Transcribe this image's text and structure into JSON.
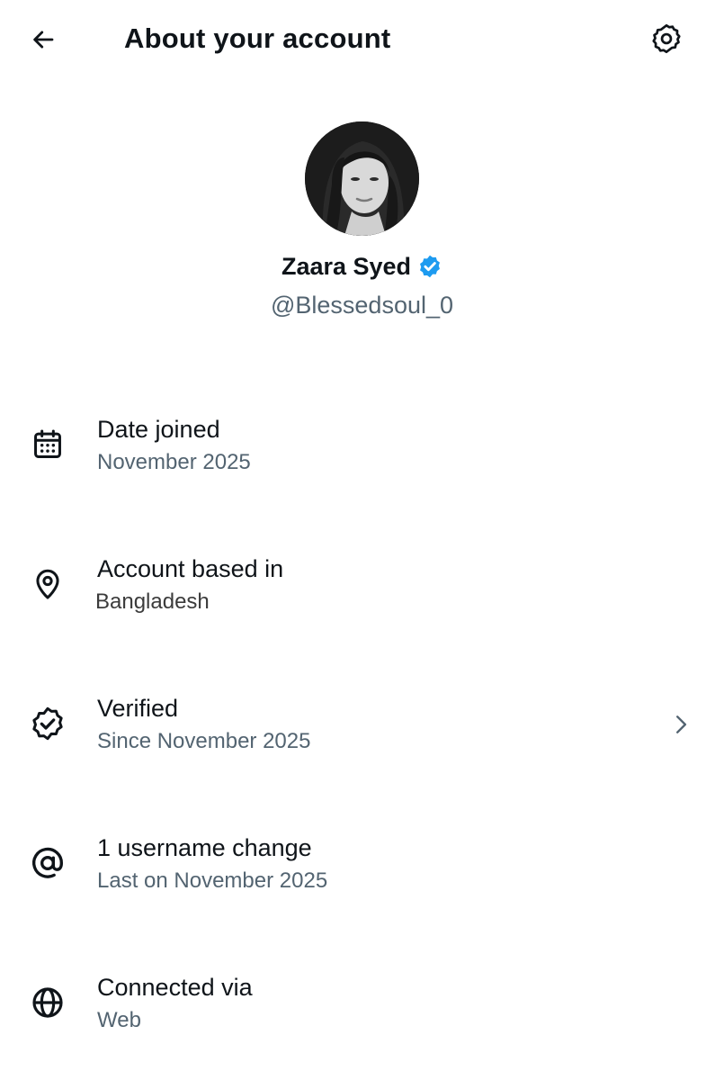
{
  "header": {
    "title": "About your account",
    "back_icon": "arrow-left-icon",
    "settings_icon": "gear-icon"
  },
  "profile": {
    "display_name": "Zaara Syed",
    "handle": "@Blessedsoul_0",
    "verified": true,
    "verified_color": "#1d9bf0",
    "avatar_icon": "profile-photo"
  },
  "rows": [
    {
      "icon": "calendar-icon",
      "label": "Date joined",
      "value": "November 2025",
      "has_chevron": false
    },
    {
      "icon": "location-pin-icon",
      "label": "Account based in",
      "value": "Bangladesh",
      "has_chevron": false
    },
    {
      "icon": "verified-check-icon",
      "label": "Verified",
      "value": "Since November 2025",
      "has_chevron": true
    },
    {
      "icon": "at-sign-icon",
      "label": "1 username change",
      "value": "Last on November 2025",
      "has_chevron": false
    },
    {
      "icon": "globe-icon",
      "label": "Connected via",
      "value": "Web",
      "has_chevron": false
    }
  ],
  "colors": {
    "text_primary": "#0f1419",
    "text_secondary": "#536471",
    "background": "#ffffff"
  }
}
